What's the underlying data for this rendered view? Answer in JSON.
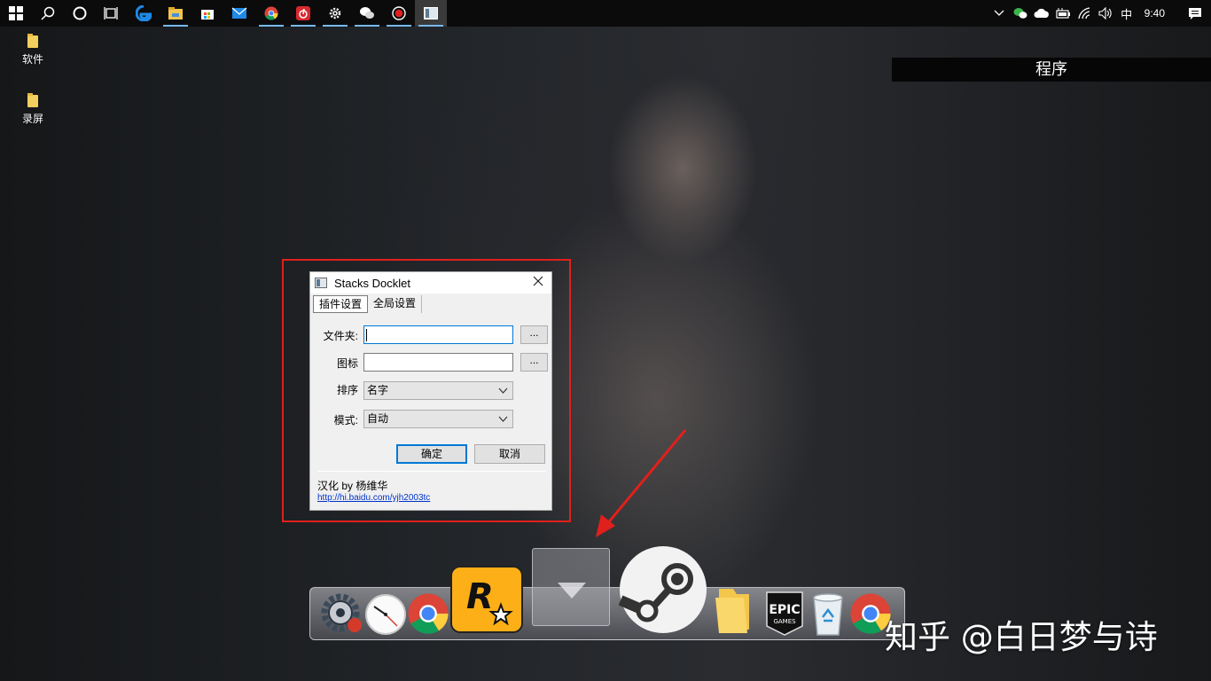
{
  "taskbar": {
    "buttons": [
      {
        "name": "start-button",
        "icon": "windows-icon"
      },
      {
        "name": "search-button",
        "icon": "search-icon"
      },
      {
        "name": "cortana-button",
        "icon": "circle-icon"
      },
      {
        "name": "task-view-button",
        "icon": "task-view-icon"
      },
      {
        "name": "edge-button",
        "icon": "edge-icon"
      },
      {
        "name": "file-explorer-button",
        "icon": "folder-icon"
      },
      {
        "name": "store-button",
        "icon": "store-icon"
      },
      {
        "name": "mail-button",
        "icon": "mail-icon"
      },
      {
        "name": "chrome-button",
        "icon": "chrome-icon"
      },
      {
        "name": "netease-music-button",
        "icon": "netease-music-icon"
      },
      {
        "name": "settings-button",
        "icon": "gear-icon"
      },
      {
        "name": "wechat-button",
        "icon": "wechat-icon"
      },
      {
        "name": "recorder-button",
        "icon": "record-icon"
      },
      {
        "name": "stacks-docklet-button",
        "icon": "window-icon"
      }
    ],
    "tray": {
      "ime": "中",
      "time": "9:40"
    }
  },
  "desktop": {
    "icons": [
      {
        "label": "软件"
      },
      {
        "label": "录屏"
      }
    ],
    "programs_label": "程序"
  },
  "dialog": {
    "title": "Stacks Docklet",
    "tabs": [
      {
        "label": "插件设置",
        "selected": true
      },
      {
        "label": "全局设置",
        "selected": false
      }
    ],
    "fields": {
      "folder": {
        "label": "文件夹:",
        "value": "",
        "browse": "..."
      },
      "icon": {
        "label": "图标",
        "value": "",
        "browse": "..."
      },
      "sort": {
        "label": "排序",
        "value": "名字"
      },
      "mode": {
        "label": "模式:",
        "value": "自动"
      }
    },
    "ok_label": "确定",
    "cancel_label": "取消",
    "credit": "汉化 by 杨维华",
    "link": "http://hi.baidu.com/yjh2003tc"
  },
  "dock": {
    "items": [
      {
        "name": "dock-settings-item",
        "icon": "gear-icon"
      },
      {
        "name": "dock-clock-item",
        "icon": "clock-icon"
      },
      {
        "name": "dock-chrome-item",
        "icon": "chrome-icon"
      },
      {
        "name": "dock-rockstar-item",
        "icon": "rockstar-icon"
      },
      {
        "name": "dock-stack-item",
        "icon": "stack-arrow-icon"
      },
      {
        "name": "dock-steam-item",
        "icon": "steam-icon"
      },
      {
        "name": "dock-folder-item",
        "icon": "folder-icon"
      },
      {
        "name": "dock-epic-item",
        "icon": "epic-games-icon"
      },
      {
        "name": "dock-recycle-bin-item",
        "icon": "recycle-bin-icon"
      },
      {
        "name": "dock-chrome-2-item",
        "icon": "chrome-icon"
      }
    ],
    "rockstar_letter": "R",
    "epic_text": "EPIC",
    "epic_sub": "GAMES"
  },
  "watermark": "知乎 @白日梦与诗",
  "colors": {
    "annotation_red": "#e0201c",
    "accent_blue": "#0078d7"
  }
}
